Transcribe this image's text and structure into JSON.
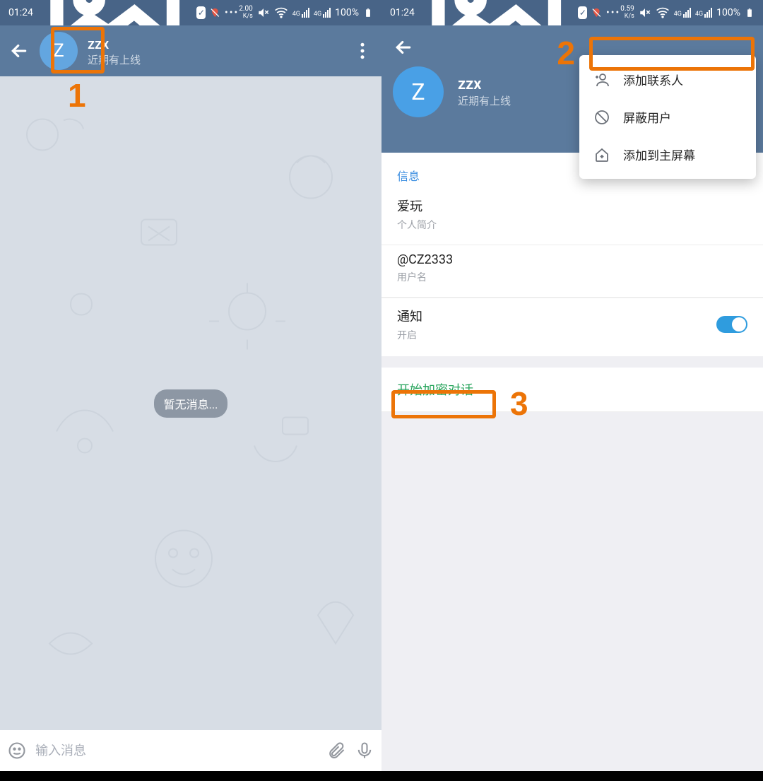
{
  "statusbar": {
    "time": "01:24",
    "speed1": "2.00",
    "speed2": "0.59",
    "speed_unit": "K/s",
    "battery": "100%",
    "net_label": "4G"
  },
  "left": {
    "avatar_letter": "Z",
    "name": "zzx",
    "status": "近期有上线",
    "empty_message": "暂无消息...",
    "input_placeholder": "输入消息"
  },
  "right": {
    "avatar_letter": "Z",
    "name": "zzx",
    "status": "近期有上线",
    "menu": {
      "add_contact": "添加联系人",
      "block_user": "屏蔽用户",
      "add_home": "添加到主屏幕"
    },
    "section_info": "信息",
    "bio_value": "爱玩",
    "bio_label": "个人简介",
    "username_value": "@CZ2333",
    "username_label": "用户名",
    "notif_title": "通知",
    "notif_state": "开启",
    "secret_chat": "开始加密对话"
  },
  "annotations": {
    "n1": "1",
    "n2": "2",
    "n3": "3"
  }
}
